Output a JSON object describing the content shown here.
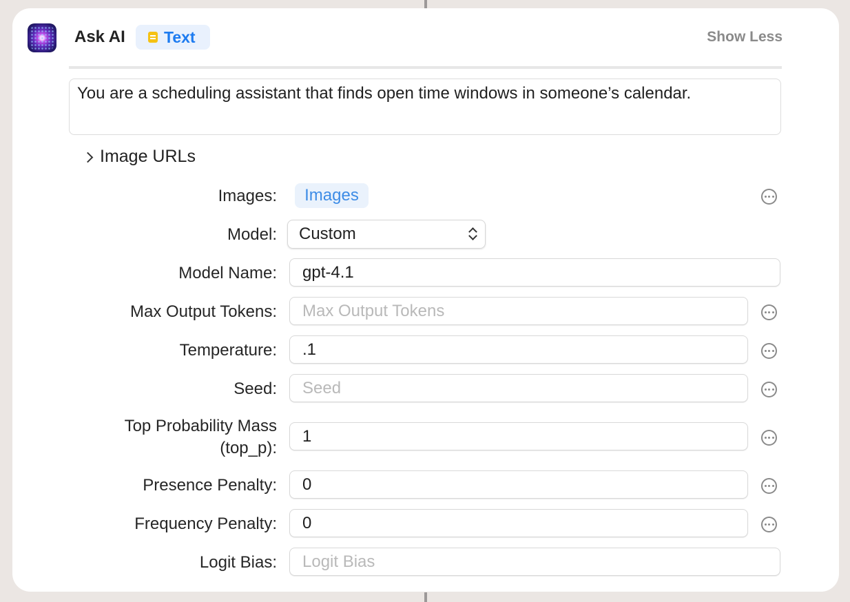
{
  "action": {
    "title": "Ask AI",
    "output_type": "Text",
    "toggle_label": "Show Less",
    "prompt_text": "You are a scheduling assistant that finds open time windows in someone’s calendar.",
    "disclosure_label": "Image URLs",
    "app_icon": "ask-ai-sparkle-icon"
  },
  "params": {
    "images": {
      "label": "Images:",
      "value": "Images"
    },
    "model": {
      "label": "Model:",
      "value": "Custom"
    },
    "model_name": {
      "label": "Model Name:",
      "value": "gpt-4.1",
      "placeholder": ""
    },
    "max_output_tokens": {
      "label": "Max Output Tokens:",
      "value": "",
      "placeholder": "Max Output Tokens"
    },
    "temperature": {
      "label": "Temperature:",
      "value": ".1",
      "placeholder": ""
    },
    "seed": {
      "label": "Seed:",
      "value": "",
      "placeholder": "Seed"
    },
    "top_p": {
      "label_line1": "Top Probability Mass",
      "label_line2": "(top_p):",
      "value": "1",
      "placeholder": ""
    },
    "presence_penalty": {
      "label": "Presence Penalty:",
      "value": "0",
      "placeholder": ""
    },
    "frequency_penalty": {
      "label": "Frequency Penalty:",
      "value": "0",
      "placeholder": ""
    },
    "logit_bias": {
      "label": "Logit Bias:",
      "value": "",
      "placeholder": "Logit Bias"
    }
  },
  "colors": {
    "accent": "#1d7bf0",
    "background": "#ebe6e3",
    "card": "#ffffff",
    "muted_text": "#8a8a8a"
  }
}
